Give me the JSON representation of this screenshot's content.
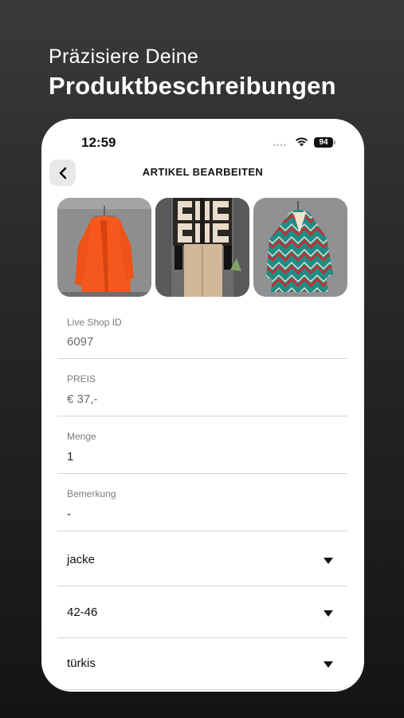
{
  "headline": {
    "line1": "Präzisiere Deine",
    "line2": "Produktbeschreibungen"
  },
  "status_bar": {
    "time": "12:59",
    "battery": "94"
  },
  "nav": {
    "title": "ARTIKEL BEARBEITEN"
  },
  "photos": [
    {
      "description_icon": "orange-cardigan-photo"
    },
    {
      "description_icon": "patterned-jacket-photo"
    },
    {
      "description_icon": "chevron-coat-photo"
    }
  ],
  "fields": {
    "shop_id": {
      "label": "Live Shop ID",
      "value": "6097"
    },
    "price": {
      "label": "PREIS",
      "value": "€ 37,-"
    },
    "quantity": {
      "label": "Menge",
      "value": "1"
    },
    "remark": {
      "label": "Bemerkung",
      "value": "-"
    }
  },
  "selects": {
    "category": "jacke",
    "size": "42-46",
    "color": "türkis"
  },
  "colors": {
    "accent_orange": "#f4581c",
    "background_dark": "#1e1e1e"
  }
}
